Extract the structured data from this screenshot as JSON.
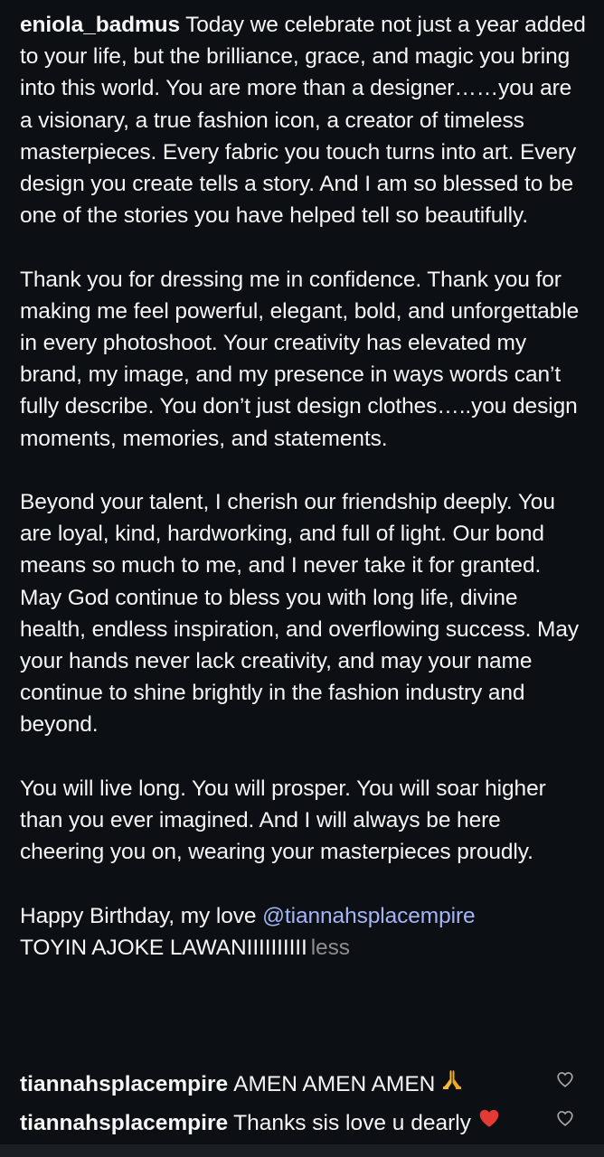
{
  "post": {
    "username": "eniola_badmus",
    "paragraphs": [
      "Today we celebrate not just a year added to your life, but the brilliance, grace, and magic you bring into this world. You are more than a designer……you are a visionary, a true fashion icon, a creator of timeless masterpieces. Every fabric you touch turns into art. Every design you create tells a story. And I am so blessed to be one of the stories you have helped tell so beautifully.",
      "Thank you for dressing me in confidence. Thank you for making me feel powerful, elegant, bold, and unforgettable in every photoshoot. Your creativity has elevated my brand, my image, and my presence in ways words can’t fully describe. You don’t just design clothes…..you design moments, memories, and statements.",
      "Beyond your talent, I cherish our friendship deeply. You are loyal, kind, hardworking, and full of light. Our bond means so much to me, and I never take it for granted. May God continue to bless you with long life, divine health, endless inspiration, and overflowing success. May your hands never lack creativity, and may your name continue to shine brightly in the fashion industry and beyond.",
      "You will live long. You will prosper. You will soar higher than you ever imagined. And I will always be here cheering you on, wearing your masterpieces proudly."
    ],
    "closing_text": "Happy Birthday, my love",
    "mention": "@tiannahsplacempire",
    "closing_line2": "TOYIN AJOKE LAWANIIIIIIIIII",
    "less_label": "less"
  },
  "comments": [
    {
      "username": "tiannahsplacempire",
      "text": "AMEN AMEN AMEN",
      "emoji_icon": "praying-hands-icon"
    },
    {
      "username": "tiannahsplacempire",
      "text": "Thanks sis love u dearly",
      "emoji_icon": "red-heart-icon"
    }
  ],
  "colors": {
    "background": "#0c1014",
    "text": "#f5f5f5",
    "mention": "#a3b5f5",
    "muted": "#8e8e8e"
  }
}
